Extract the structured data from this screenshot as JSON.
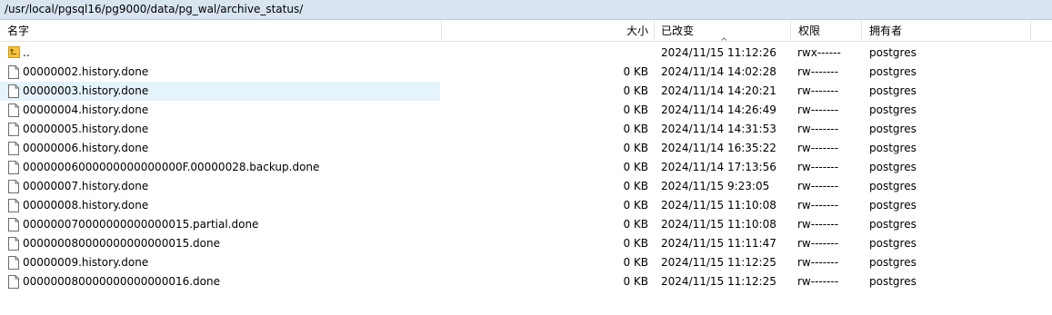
{
  "path": "/usr/local/pgsql16/pg9000/data/pg_wal/archive_status/",
  "columns": {
    "name": "名字",
    "size": "大小",
    "modified": "已改变",
    "permissions": "权限",
    "owner": "拥有者"
  },
  "sort_indicator": "^",
  "rows": [
    {
      "icon": "parent-folder-icon",
      "name": "..",
      "size": "",
      "modified": "2024/11/15 11:12:26",
      "perm": "rwx------",
      "owner": "postgres"
    },
    {
      "icon": "file-icon",
      "name": "00000002.history.done",
      "size": "0 KB",
      "modified": "2024/11/14 14:02:28",
      "perm": "rw-------",
      "owner": "postgres"
    },
    {
      "icon": "file-icon",
      "name": "00000003.history.done",
      "size": "0 KB",
      "modified": "2024/11/14 14:20:21",
      "perm": "rw-------",
      "owner": "postgres"
    },
    {
      "icon": "file-icon",
      "name": "00000004.history.done",
      "size": "0 KB",
      "modified": "2024/11/14 14:26:49",
      "perm": "rw-------",
      "owner": "postgres"
    },
    {
      "icon": "file-icon",
      "name": "00000005.history.done",
      "size": "0 KB",
      "modified": "2024/11/14 14:31:53",
      "perm": "rw-------",
      "owner": "postgres"
    },
    {
      "icon": "file-icon",
      "name": "00000006.history.done",
      "size": "0 KB",
      "modified": "2024/11/14 16:35:22",
      "perm": "rw-------",
      "owner": "postgres"
    },
    {
      "icon": "file-icon",
      "name": "00000006000000000000000F.00000028.backup.done",
      "size": "0 KB",
      "modified": "2024/11/14 17:13:56",
      "perm": "rw-------",
      "owner": "postgres"
    },
    {
      "icon": "file-icon",
      "name": "00000007.history.done",
      "size": "0 KB",
      "modified": "2024/11/15 9:23:05",
      "perm": "rw-------",
      "owner": "postgres"
    },
    {
      "icon": "file-icon",
      "name": "00000008.history.done",
      "size": "0 KB",
      "modified": "2024/11/15 11:10:08",
      "perm": "rw-------",
      "owner": "postgres"
    },
    {
      "icon": "file-icon",
      "name": "000000070000000000000015.partial.done",
      "size": "0 KB",
      "modified": "2024/11/15 11:10:08",
      "perm": "rw-------",
      "owner": "postgres"
    },
    {
      "icon": "file-icon",
      "name": "000000080000000000000015.done",
      "size": "0 KB",
      "modified": "2024/11/15 11:11:47",
      "perm": "rw-------",
      "owner": "postgres"
    },
    {
      "icon": "file-icon",
      "name": "00000009.history.done",
      "size": "0 KB",
      "modified": "2024/11/15 11:12:25",
      "perm": "rw-------",
      "owner": "postgres"
    },
    {
      "icon": "file-icon",
      "name": "000000080000000000000016.done",
      "size": "0 KB",
      "modified": "2024/11/15 11:12:25",
      "perm": "rw-------",
      "owner": "postgres"
    }
  ],
  "hover_row": 2,
  "colors": {
    "path_bar_bg": "#d9e4f1",
    "hover_bg": "#e5f3fb",
    "folder_icon": "#f5c242"
  }
}
